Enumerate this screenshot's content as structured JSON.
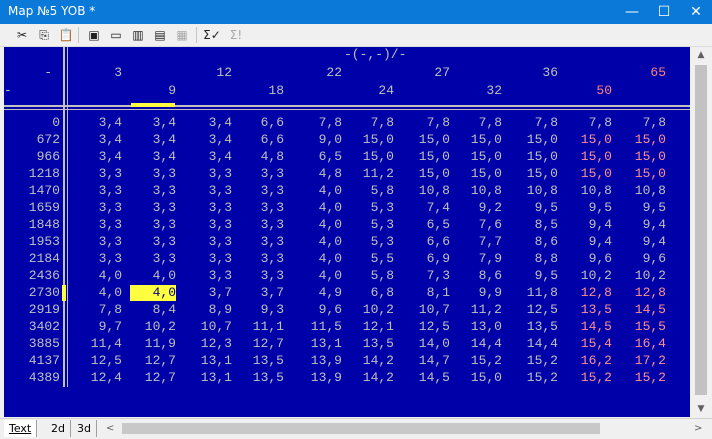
{
  "window": {
    "title": "Map №5 YOB *",
    "minimize_glyph": "—",
    "maximize_glyph": "☐",
    "close_glyph": "✕"
  },
  "toolbar": {
    "buttons": [
      {
        "name": "cut-button",
        "glyph": "✂",
        "enabled": true
      },
      {
        "name": "copy-button",
        "glyph": "⎘",
        "enabled": true
      },
      {
        "name": "paste-button",
        "glyph": "📋",
        "enabled": false
      },
      {
        "name": "insert-row-button",
        "glyph": "▣",
        "enabled": true
      },
      {
        "name": "delete-row-button",
        "glyph": "▭",
        "enabled": true
      },
      {
        "name": "insert-column-button",
        "glyph": "▥",
        "enabled": true
      },
      {
        "name": "delete-column-button",
        "glyph": "▤",
        "enabled": true
      },
      {
        "name": "interpolate-button",
        "glyph": "▦",
        "enabled": false
      },
      {
        "name": "sum-check-button",
        "glyph": "Σ✓",
        "enabled": true
      },
      {
        "name": "sum-warning-button",
        "glyph": "Σ!",
        "enabled": false
      }
    ]
  },
  "map": {
    "axis_label": "-(-,-)/-",
    "corner_top": "-",
    "corner_bottom": "-",
    "columns_odd": [
      "3",
      "12",
      "22",
      "27",
      "36",
      "65"
    ],
    "columns_even": [
      "9",
      "18",
      "24",
      "32",
      "50"
    ],
    "rows": [
      {
        "label": "0",
        "values": [
          "3,4",
          "3,4",
          "3,4",
          "6,6",
          "7,8",
          "7,8",
          "7,8",
          "7,8",
          "7,8",
          "7,8",
          "7,8"
        ]
      },
      {
        "label": "672",
        "values": [
          "3,4",
          "3,4",
          "3,4",
          "6,6",
          "9,0",
          "15,0",
          "15,0",
          "15,0",
          "15,0",
          "15,0",
          "15,0"
        ]
      },
      {
        "label": "966",
        "values": [
          "3,4",
          "3,4",
          "3,4",
          "4,8",
          "6,5",
          "15,0",
          "15,0",
          "15,0",
          "15,0",
          "15,0",
          "15,0"
        ]
      },
      {
        "label": "1218",
        "values": [
          "3,3",
          "3,3",
          "3,3",
          "3,3",
          "4,8",
          "11,2",
          "15,0",
          "15,0",
          "15,0",
          "15,0",
          "15,0"
        ]
      },
      {
        "label": "1470",
        "values": [
          "3,3",
          "3,3",
          "3,3",
          "3,3",
          "4,0",
          "5,8",
          "10,8",
          "10,8",
          "10,8",
          "10,8",
          "10,8"
        ]
      },
      {
        "label": "1659",
        "values": [
          "3,3",
          "3,3",
          "3,3",
          "3,3",
          "4,0",
          "5,3",
          "7,4",
          "9,2",
          "9,5",
          "9,5",
          "9,5"
        ]
      },
      {
        "label": "1848",
        "values": [
          "3,3",
          "3,3",
          "3,3",
          "3,3",
          "4,0",
          "5,3",
          "6,5",
          "7,6",
          "8,5",
          "9,4",
          "9,4"
        ]
      },
      {
        "label": "1953",
        "values": [
          "3,3",
          "3,3",
          "3,3",
          "3,3",
          "4,0",
          "5,3",
          "6,6",
          "7,7",
          "8,6",
          "9,4",
          "9,4"
        ]
      },
      {
        "label": "2184",
        "values": [
          "3,3",
          "3,3",
          "3,3",
          "3,3",
          "4,0",
          "5,5",
          "6,9",
          "7,9",
          "8,8",
          "9,6",
          "9,6"
        ]
      },
      {
        "label": "2436",
        "values": [
          "4,0",
          "4,0",
          "3,3",
          "3,3",
          "4,0",
          "5,8",
          "7,3",
          "8,6",
          "9,5",
          "10,2",
          "10,2"
        ]
      },
      {
        "label": "2730",
        "values": [
          "4,0",
          "4,0",
          "3,7",
          "3,7",
          "4,9",
          "6,8",
          "8,1",
          "9,9",
          "11,8",
          "12,8",
          "12,8"
        ]
      },
      {
        "label": "2919",
        "values": [
          "7,8",
          "8,4",
          "8,9",
          "9,3",
          "9,6",
          "10,2",
          "10,7",
          "11,2",
          "12,5",
          "13,5",
          "14,5"
        ]
      },
      {
        "label": "3402",
        "values": [
          "9,7",
          "10,2",
          "10,7",
          "11,1",
          "11,5",
          "12,1",
          "12,5",
          "13,0",
          "13,5",
          "14,5",
          "15,5"
        ]
      },
      {
        "label": "3885",
        "values": [
          "11,4",
          "11,9",
          "12,3",
          "12,7",
          "13,1",
          "13,5",
          "14,0",
          "14,4",
          "14,4",
          "15,4",
          "16,4"
        ]
      },
      {
        "label": "4137",
        "values": [
          "12,5",
          "12,7",
          "13,1",
          "13,5",
          "13,9",
          "14,2",
          "14,7",
          "15,2",
          "15,2",
          "16,2",
          "17,2"
        ]
      },
      {
        "label": "4389",
        "values": [
          "12,4",
          "12,7",
          "13,1",
          "13,5",
          "13,9",
          "14,2",
          "14,5",
          "15,0",
          "15,2",
          "15,2",
          "15,2"
        ]
      }
    ],
    "selected_cell": {
      "row": 10,
      "col": 1
    },
    "highlight_threshold": 12.5
  },
  "tabs": [
    {
      "label": "Text",
      "active": true
    },
    {
      "label": "2d",
      "active": false
    },
    {
      "label": "3d",
      "active": false
    }
  ],
  "scroll": {
    "up_arrow": "▲",
    "down_arrow": "▼",
    "left_arrow": "<",
    "right_arrow": ">"
  },
  "colors": {
    "map_background": "#0000a8",
    "cell_text": "#c0c0c0",
    "high_value_text": "#ff8080",
    "selection": "#ffff40"
  }
}
